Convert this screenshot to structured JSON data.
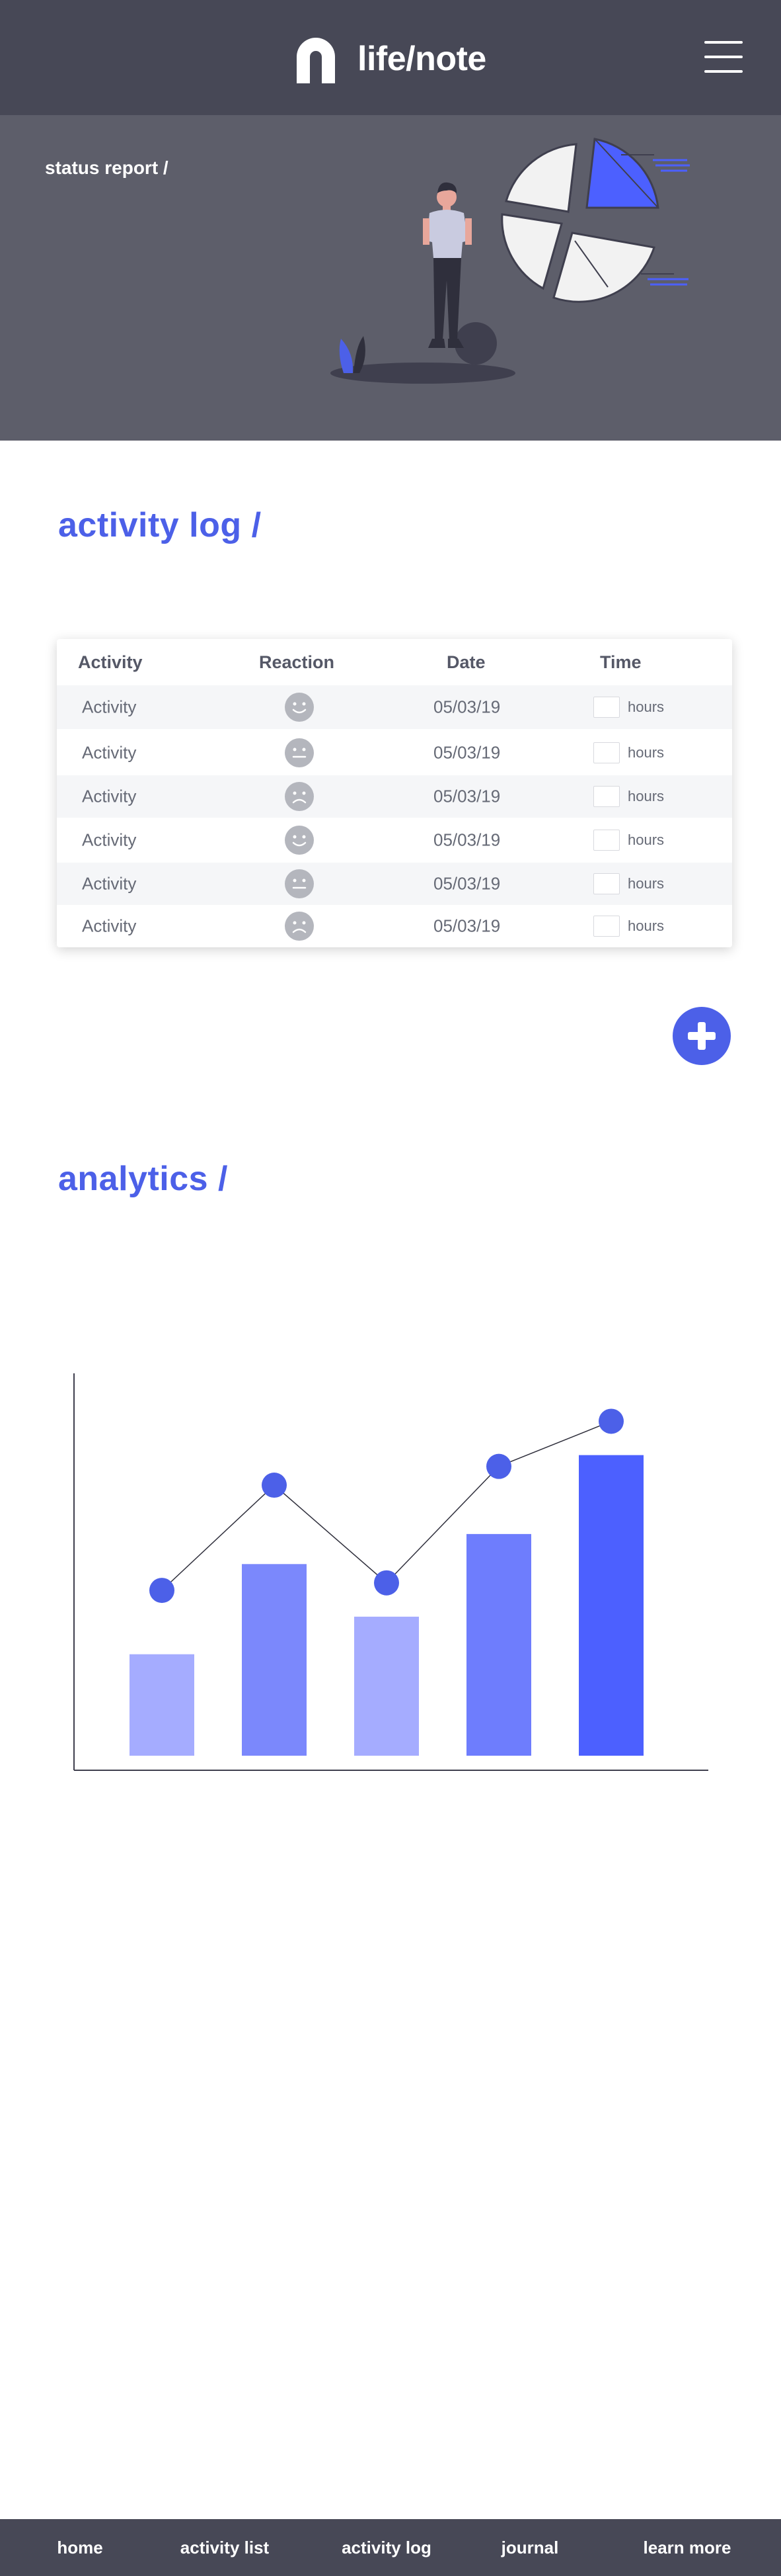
{
  "header": {
    "brand": "life/note",
    "logo_icon": "n-logo-icon",
    "menu_icon": "hamburger-menu-icon"
  },
  "hero": {
    "title": "status report /",
    "illustration": "person-with-pie-chart-illustration"
  },
  "activity_log": {
    "title": "activity log /",
    "columns": [
      "Activity",
      "Reaction",
      "Date",
      "Time"
    ],
    "rows": [
      {
        "activity": "Activity",
        "reaction": "smile-face-icon",
        "date": "05/03/19",
        "time_unit": "hours"
      },
      {
        "activity": "Activity",
        "reaction": "neutral-face-icon",
        "date": "05/03/19",
        "time_unit": "hours"
      },
      {
        "activity": "Activity",
        "reaction": "frown-face-icon",
        "date": "05/03/19",
        "time_unit": "hours"
      },
      {
        "activity": "Activity",
        "reaction": "smile-face-icon",
        "date": "05/03/19",
        "time_unit": "hours"
      },
      {
        "activity": "Activity",
        "reaction": "neutral-face-icon",
        "date": "05/03/19",
        "time_unit": "hours"
      },
      {
        "activity": "Activity",
        "reaction": "frown-face-icon",
        "date": "05/03/19",
        "time_unit": "hours"
      }
    ],
    "add_button_icon": "plus-icon"
  },
  "analytics": {
    "title": "analytics /"
  },
  "chart_data": {
    "type": "bar",
    "categories": [
      "",
      "",
      "",
      "",
      ""
    ],
    "values": [
      27,
      51,
      37,
      59,
      80
    ],
    "line_values": [
      44,
      72,
      46,
      77,
      89
    ],
    "ylim": [
      0,
      100
    ],
    "grid": false,
    "bar_colors": [
      "#a5acff",
      "#7b88fc",
      "#a5acff",
      "#6e7dfd",
      "#4c60ff"
    ],
    "line_color": "#4c60e8"
  },
  "colors": {
    "accent": "#4c60e8",
    "header_bg": "#474856",
    "hero_bg": "#5d5e6a"
  },
  "footer": {
    "items": [
      "home",
      "activity list",
      "activity log",
      "journal",
      "learn more"
    ]
  }
}
